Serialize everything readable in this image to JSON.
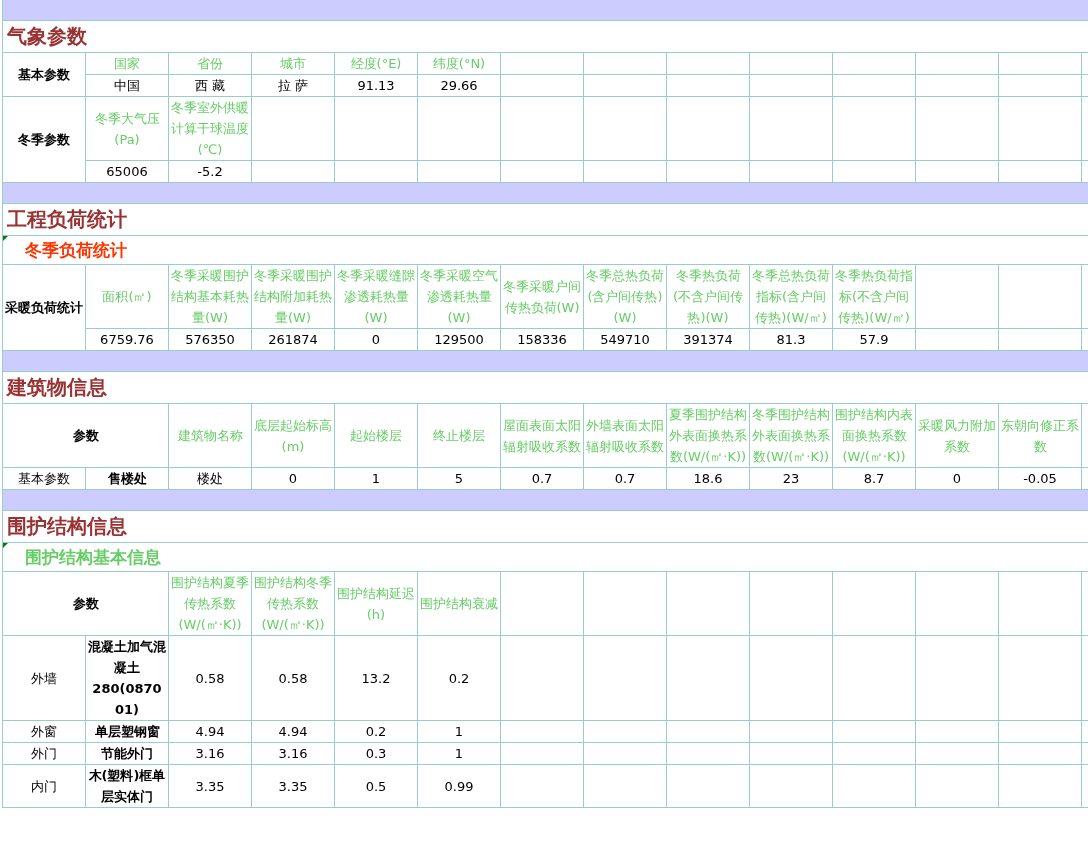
{
  "sections": [
    {
      "kind": "band"
    },
    {
      "kind": "title",
      "text": "气象参数"
    },
    {
      "kind": "table",
      "groups": [
        {
          "label": {
            "text": "基本参数",
            "kind": "strong"
          },
          "rows": [
            [
              {
                "text": "国家",
                "kind": "header"
              },
              {
                "text": "省份",
                "kind": "header"
              },
              {
                "text": "城市",
                "kind": "header"
              },
              {
                "text": "经度(°E)",
                "kind": "header"
              },
              {
                "text": "纬度(°N)",
                "kind": "header"
              }
            ],
            [
              {
                "text": "中国",
                "kind": "value"
              },
              {
                "text": "西 藏",
                "kind": "value"
              },
              {
                "text": "拉 萨",
                "kind": "value"
              },
              {
                "text": "91.13",
                "kind": "value"
              },
              {
                "text": "29.66",
                "kind": "value"
              }
            ]
          ]
        },
        {
          "label": {
            "text": "冬季参数",
            "kind": "strong"
          },
          "rows": [
            [
              {
                "text": "冬季大气压(Pa)",
                "kind": "header"
              },
              {
                "text": "冬季室外供暖计算干球温度(℃)",
                "kind": "header"
              }
            ],
            [
              {
                "text": "65006",
                "kind": "value"
              },
              {
                "text": "-5.2",
                "kind": "value"
              }
            ]
          ]
        }
      ]
    },
    {
      "kind": "band"
    },
    {
      "kind": "title",
      "text": "工程负荷统计"
    },
    {
      "kind": "subtitle",
      "text": "冬季负荷统计",
      "color": "#ff3300"
    },
    {
      "kind": "table",
      "groups": [
        {
          "label": {
            "text": "采暖负荷统计",
            "kind": "strong"
          },
          "rows": [
            [
              {
                "text": "面积(㎡)",
                "kind": "header"
              },
              {
                "text": "冬季采暖围护结构基本耗热量(W)",
                "kind": "header"
              },
              {
                "text": "冬季采暖围护结构附加耗热量(W)",
                "kind": "header"
              },
              {
                "text": "冬季采暖缝隙渗透耗热量(W)",
                "kind": "header"
              },
              {
                "text": "冬季采暖空气渗透耗热量(W)",
                "kind": "header"
              },
              {
                "text": "冬季采暖户间传热负荷(W)",
                "kind": "header"
              },
              {
                "text": "冬季总热负荷(含户间传热)(W)",
                "kind": "header"
              },
              {
                "text": "冬季热负荷(不含户间传热)(W)",
                "kind": "header"
              },
              {
                "text": "冬季总热负荷指标(含户间传热)(W/㎡)",
                "kind": "header"
              },
              {
                "text": "冬季热负荷指标(不含户间传热)(W/㎡)",
                "kind": "header"
              }
            ],
            [
              {
                "text": "6759.76",
                "kind": "value"
              },
              {
                "text": "576350",
                "kind": "value"
              },
              {
                "text": "261874",
                "kind": "value"
              },
              {
                "text": "0",
                "kind": "value"
              },
              {
                "text": "129500",
                "kind": "value"
              },
              {
                "text": "158336",
                "kind": "value"
              },
              {
                "text": "549710",
                "kind": "value"
              },
              {
                "text": "391374",
                "kind": "value"
              },
              {
                "text": "81.3",
                "kind": "value"
              },
              {
                "text": "57.9",
                "kind": "value"
              }
            ]
          ]
        }
      ]
    },
    {
      "kind": "band"
    },
    {
      "kind": "title",
      "text": "建筑物信息"
    },
    {
      "kind": "table",
      "groups": [
        {
          "label": {
            "text": "参数",
            "kind": "strong"
          },
          "wide": true,
          "rows": [
            [
              {
                "text": "建筑物名称",
                "kind": "header"
              },
              {
                "text": "底层起始标高(m)",
                "kind": "header"
              },
              {
                "text": "起始楼层",
                "kind": "header"
              },
              {
                "text": "终止楼层",
                "kind": "header"
              },
              {
                "text": "屋面表面太阳辐射吸收系数",
                "kind": "header"
              },
              {
                "text": "外墙表面太阳辐射吸收系数",
                "kind": "header"
              },
              {
                "text": "夏季围护结构外表面换热系数(W/(㎡·K))",
                "kind": "header"
              },
              {
                "text": "冬季围护结构外表面换热系数(W/(㎡·K))",
                "kind": "header"
              },
              {
                "text": "围护结构内表面换热系数(W/(㎡·K))",
                "kind": "header"
              },
              {
                "text": "采暖风力附加系数",
                "kind": "header"
              },
              {
                "text": "东朝向修正系数",
                "kind": "header"
              }
            ]
          ]
        },
        {
          "label": {
            "text": "基本参数",
            "kind": "value"
          },
          "rows": [
            [
              {
                "text": "售楼处",
                "kind": "strong"
              },
              {
                "text": "楼处",
                "kind": "value"
              },
              {
                "text": "0",
                "kind": "value"
              },
              {
                "text": "1",
                "kind": "value"
              },
              {
                "text": "5",
                "kind": "value"
              },
              {
                "text": "0.7",
                "kind": "value"
              },
              {
                "text": "0.7",
                "kind": "value"
              },
              {
                "text": "18.6",
                "kind": "value"
              },
              {
                "text": "23",
                "kind": "value"
              },
              {
                "text": "8.7",
                "kind": "value"
              },
              {
                "text": "0",
                "kind": "value"
              },
              {
                "text": "-0.05",
                "kind": "value"
              }
            ]
          ]
        }
      ]
    },
    {
      "kind": "band"
    },
    {
      "kind": "title",
      "text": "围护结构信息"
    },
    {
      "kind": "subtitle",
      "text": "围护结构基本信息",
      "color": "#66cc66"
    },
    {
      "kind": "table",
      "groups": [
        {
          "label": {
            "text": "参数",
            "kind": "strong"
          },
          "wide": true,
          "rows": [
            [
              {
                "text": "围护结构夏季传热系数(W/(㎡·K))",
                "kind": "header"
              },
              {
                "text": "围护结构冬季传热系数(W/(㎡·K))",
                "kind": "header"
              },
              {
                "text": "围护结构延迟(h)",
                "kind": "header"
              },
              {
                "text": "围护结构衰减",
                "kind": "header"
              }
            ]
          ]
        },
        {
          "label": {
            "text": "外墙",
            "kind": "value"
          },
          "rows": [
            [
              {
                "text": "混凝土加气混凝土280(087001)",
                "kind": "strong"
              },
              {
                "text": "0.58",
                "kind": "value"
              },
              {
                "text": "0.58",
                "kind": "value"
              },
              {
                "text": "13.2",
                "kind": "value"
              },
              {
                "text": "0.2",
                "kind": "value"
              }
            ]
          ]
        },
        {
          "label": {
            "text": "外窗",
            "kind": "value"
          },
          "rows": [
            [
              {
                "text": "单层塑钢窗",
                "kind": "strong"
              },
              {
                "text": "4.94",
                "kind": "value"
              },
              {
                "text": "4.94",
                "kind": "value"
              },
              {
                "text": "0.2",
                "kind": "value"
              },
              {
                "text": "1",
                "kind": "value"
              }
            ]
          ]
        },
        {
          "label": {
            "text": "外门",
            "kind": "value"
          },
          "rows": [
            [
              {
                "text": "节能外门",
                "kind": "strong"
              },
              {
                "text": "3.16",
                "kind": "value"
              },
              {
                "text": "3.16",
                "kind": "value"
              },
              {
                "text": "0.3",
                "kind": "value"
              },
              {
                "text": "1",
                "kind": "value"
              }
            ]
          ]
        },
        {
          "label": {
            "text": "内门",
            "kind": "value"
          },
          "rows": [
            [
              {
                "text": "木(塑料)框单层实体门",
                "kind": "strong"
              },
              {
                "text": "3.35",
                "kind": "value"
              },
              {
                "text": "3.35",
                "kind": "value"
              },
              {
                "text": "0.5",
                "kind": "value"
              },
              {
                "text": "0.99",
                "kind": "value"
              }
            ]
          ]
        }
      ]
    }
  ]
}
